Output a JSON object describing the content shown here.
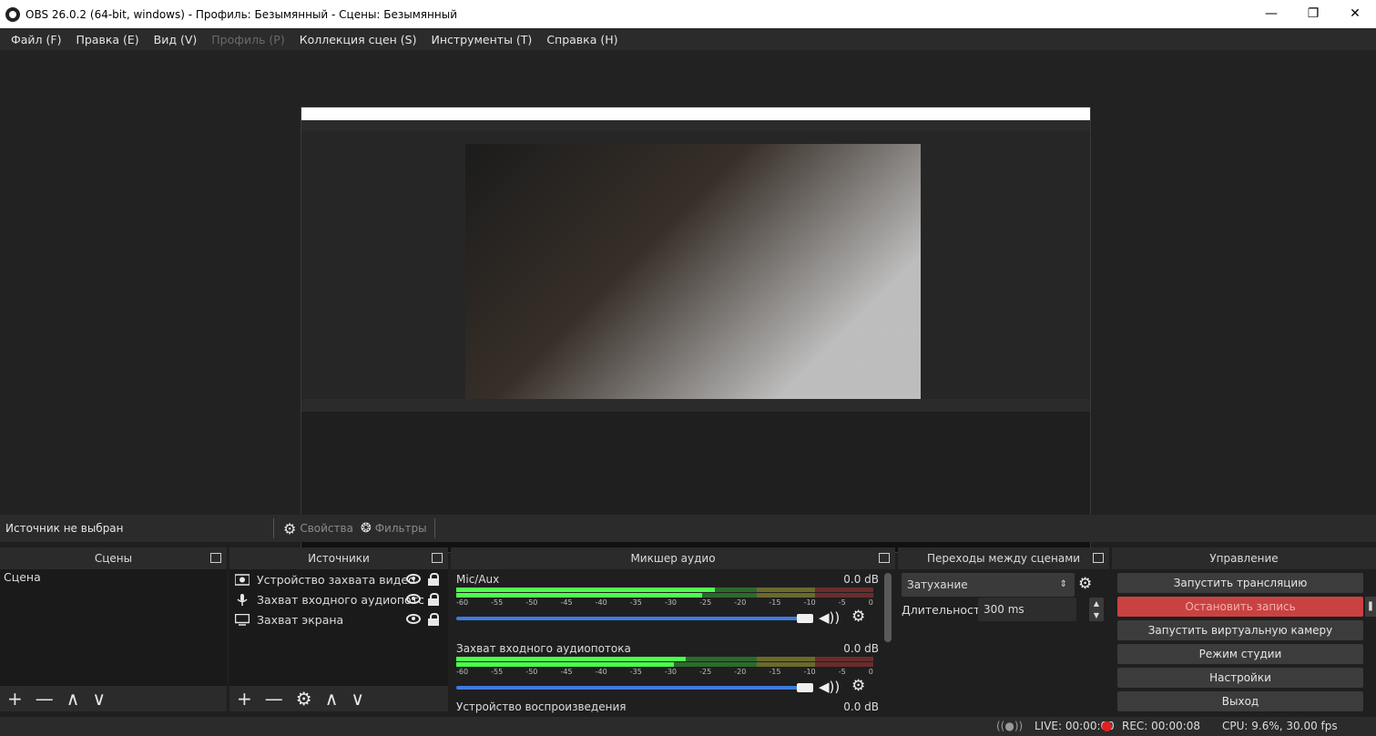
{
  "window": {
    "title": "OBS 26.0.2 (64-bit, windows) - Профиль: Безымянный - Сцены: Безымянный",
    "minimize_glyph": "—",
    "maximize_glyph": "❐",
    "close_glyph": "✕"
  },
  "menu": {
    "file": "Файл (F)",
    "edit": "Правка (E)",
    "view": "Вид (V)",
    "profile": "Профиль (P)",
    "scene_collection": "Коллекция сцен (S)",
    "tools": "Инструменты (T)",
    "help": "Справка (H)"
  },
  "source_bar": {
    "no_source": "Источник не выбран",
    "properties": "Свойства",
    "filters": "Фильтры"
  },
  "scenes": {
    "header": "Сцены",
    "items": [
      "Сцена"
    ],
    "footer": {
      "add": "+",
      "remove": "—",
      "up": "∧",
      "down": "∨"
    }
  },
  "sources": {
    "header": "Источники",
    "items": [
      {
        "label": "Устройство захвата видео",
        "icon": "camera-icon"
      },
      {
        "label": "Захват входного аудиопотс",
        "icon": "mic-icon"
      },
      {
        "label": "Захват экрана",
        "icon": "monitor-icon"
      }
    ],
    "footer": {
      "add": "+",
      "remove": "—",
      "settings": "⚙",
      "up": "∧",
      "down": "∨"
    }
  },
  "mixer": {
    "header": "Микшер аудио",
    "scale": [
      "-60",
      "-55",
      "-50",
      "-45",
      "-40",
      "-35",
      "-30",
      "-25",
      "-20",
      "-15",
      "-10",
      "-5",
      "0"
    ],
    "tracks": [
      {
        "name": "Mic/Aux",
        "db": "0.0 dB",
        "level": 0.62,
        "volume": 1.0
      },
      {
        "name": "Захват входного аудиопотока",
        "db": "0.0 dB",
        "level": 0.55,
        "volume": 1.0
      },
      {
        "name": "Устройство воспроизведения",
        "db": "0.0 dB"
      }
    ],
    "volume_glyph": "◀))",
    "gear_glyph": "⚙"
  },
  "transitions": {
    "header": "Переходы между сценами",
    "selected": "Затухание",
    "duration_label": "Длительность",
    "duration_value": "300 ms",
    "gear_glyph": "⚙"
  },
  "controls": {
    "header": "Управление",
    "start_stream": "Запустить трансляцию",
    "stop_recording": "Остановить запись",
    "start_virtual_cam": "Запустить виртуальную камеру",
    "studio_mode": "Режим студии",
    "settings": "Настройки",
    "exit": "Выход"
  },
  "status": {
    "live": "LIVE: 00:00:00",
    "rec": "REC: 00:00:08",
    "cpu": "CPU: 9.6%, 30.00 fps"
  },
  "colors": {
    "accent": "#3f7be0",
    "record_red": "#c94242",
    "rec_dot": "#e02020"
  }
}
